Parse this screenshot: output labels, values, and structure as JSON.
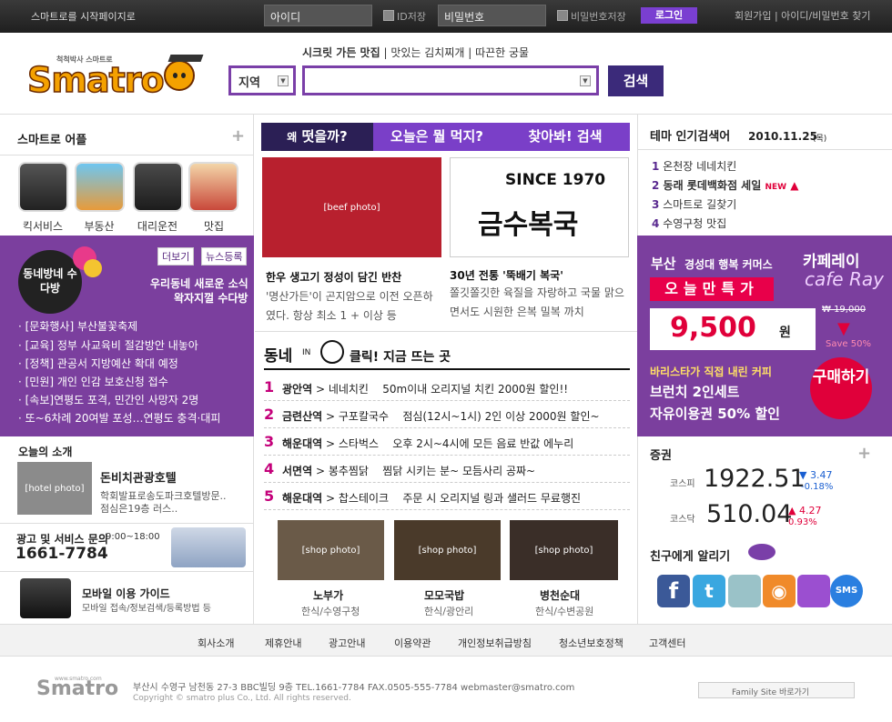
{
  "topbar": {
    "home_link": "스마트로를 시작페이지로",
    "id_placeholder": "아이디",
    "save_id": "ID저장",
    "pw_placeholder": "비밀번호",
    "save_pw": "비밀번호저장",
    "login": "로그인",
    "links": "회원가입 | 아이디/비밀번호 찾기"
  },
  "header": {
    "tagline_bold": "시크릿 가든 맛집",
    "tagline_rest": " | 맛있는 김치찌개 | 따끈한 궁물",
    "region": "지역",
    "search_btn": "검색"
  },
  "left": {
    "apps_title": "스마트로 어플",
    "apps": [
      "킥서비스",
      "부동산",
      "대리운전",
      "맛집"
    ],
    "sudabang_badge": "동네방네 수다방",
    "more_btn": "더보기",
    "news_btn": "뉴스등록",
    "sudabang_desc1": "우리동네 새로운 소식",
    "sudabang_desc2": "왁자지껄 수다방",
    "news": [
      "· [문화행사] 부산불꽃축제",
      "· [교육] 정부 사교육비 절감방안 내놓아",
      "· [정책] 관공서 지방예산 확대 예정",
      "· [민원] 개인 인감 보호신청 접수",
      "· [속보]연평도 포격, 민간인 사망자 2명",
      "· 또~6차례 20여발 포성…연평도 충격·대피"
    ],
    "today_title": "오늘의 소개",
    "hotel_name": "돈비치관광호텔",
    "hotel_desc1": "학회발표로송도파크호텔방문..",
    "hotel_desc2": "점심은19층 러스..",
    "ad_title": "광고 및 서비스 문의",
    "ad_hours": "9:00~18:00",
    "ad_phone": "1661-7784",
    "mobile_title": "모바일 이용 가이드",
    "mobile_desc": "모바일 접속/정보검색/등록방법 등"
  },
  "center": {
    "tabs": [
      "왜 떳을까?",
      "오늘은 뭘 먹지?",
      "찾아봐! 검색"
    ],
    "tab_prefix": "왜",
    "tab1_main": "떳을까?",
    "card1_title": "한우 생고기 정성이 담긴 반찬",
    "card1_desc": "'명산가든'이 곤지암으로 이전 오픈하였다. 항상 최소 1 + 이상 등",
    "card2_logo_top": "SINCE 1970",
    "card2_logo": "금수복국",
    "card2_title": "30년 전통 '뚝배기 복국'",
    "card2_desc": "쫄깃쫄깃한 육질을 자랑하고 국물 맑으면서도 시원한 은복 밀복 까치",
    "hot_title_a": "동네",
    "hot_title_in": "IN",
    "hot_title_b": "클릭! 지금 뜨는 곳",
    "ranks": [
      {
        "n": "1",
        "station": "광안역",
        "place": "네네치킨",
        "desc": "50m이내 오리지널 치킨 2000원 할인!!"
      },
      {
        "n": "2",
        "station": "금련산역",
        "place": "구포칼국수",
        "desc": "점심(12시~1시) 2인 이상 2000원 할인~"
      },
      {
        "n": "3",
        "station": "해운대역",
        "place": "스타벅스",
        "desc": "오후 2시~4시에 모든 음료 반값 에누리"
      },
      {
        "n": "4",
        "station": "서면역",
        "place": "봉추찜닭",
        "desc": "찜닭 시키는 분~ 모듬사리 공짜~"
      },
      {
        "n": "5",
        "station": "해운대역",
        "place": "찹스테이크",
        "desc": "주문 시 오리지널 링과 샐러드 무료행진"
      }
    ],
    "shops": [
      {
        "name": "노부가",
        "cat": "한식/수영구청"
      },
      {
        "name": "모모국밥",
        "cat": "한식/광안리"
      },
      {
        "name": "병천순대",
        "cat": "한식/수변공원"
      }
    ]
  },
  "right": {
    "theme_title": "테마 인기검색어",
    "theme_date": "2010.11.25",
    "theme_day": "(목)",
    "keywords": [
      "온천장 네네치킨",
      "동래 롯데백화점 세일",
      "스마트로 길찾기",
      "수영구청 맛집"
    ],
    "new_badge": "NEW",
    "promo_region": "부산",
    "promo_sub": "경성대 행복 커머스",
    "promo_special": "오늘만특가",
    "promo_brand": "카페레이",
    "promo_brand_en": "cafe Ray",
    "promo_price": "9,500",
    "promo_won": "원",
    "promo_orig": "₩ 19,000",
    "promo_save": "Save 50%",
    "promo_line1": "바리스타가 직접 내린 커피",
    "promo_line2": "브런치 2인세트",
    "promo_line3": "자유이용권 50% 할인",
    "buy_btn": "구매하기",
    "stock_title": "증권",
    "kospi_label": "코스피",
    "kospi": "1922.51",
    "kospi_chg": "▼ 3.47",
    "kospi_pct": "-0.18%",
    "kosdaq_label": "코스닥",
    "kosdaq": "510.04",
    "kosdaq_chg": "▲ 4.27",
    "kosdaq_pct": "0.93%",
    "share_title": "친구에게 알리기",
    "share_icons": [
      "facebook-icon",
      "twitter-icon",
      "me2day-icon",
      "rss-icon",
      "yozm-icon",
      "sms-icon"
    ]
  },
  "footer": {
    "nav": [
      "회사소개",
      "제휴안내",
      "광고안내",
      "이용약관",
      "개인정보취급방침",
      "청소년보호정책",
      "고객센터"
    ],
    "address": "부산시 수영구 남천동 27-3 BBC빌딩 9층 TEL.1661-7784 FAX.0505-555-7784 webmaster@smatro.com",
    "copyright": "Copyright © smatro plus  Co., Ltd. All rights reserved.",
    "family": "Family Site 바로가기",
    "logo_url": "www.smatro.com",
    "logo_text": "Smatro"
  },
  "logo": {
    "tagline": "척척박사 스마트로",
    "text": "Smatro"
  },
  "colors": {
    "purple": "#7b3f9e",
    "accent_pink": "#c4007a",
    "red": "#e0003a",
    "navy": "#3b2a7a"
  }
}
